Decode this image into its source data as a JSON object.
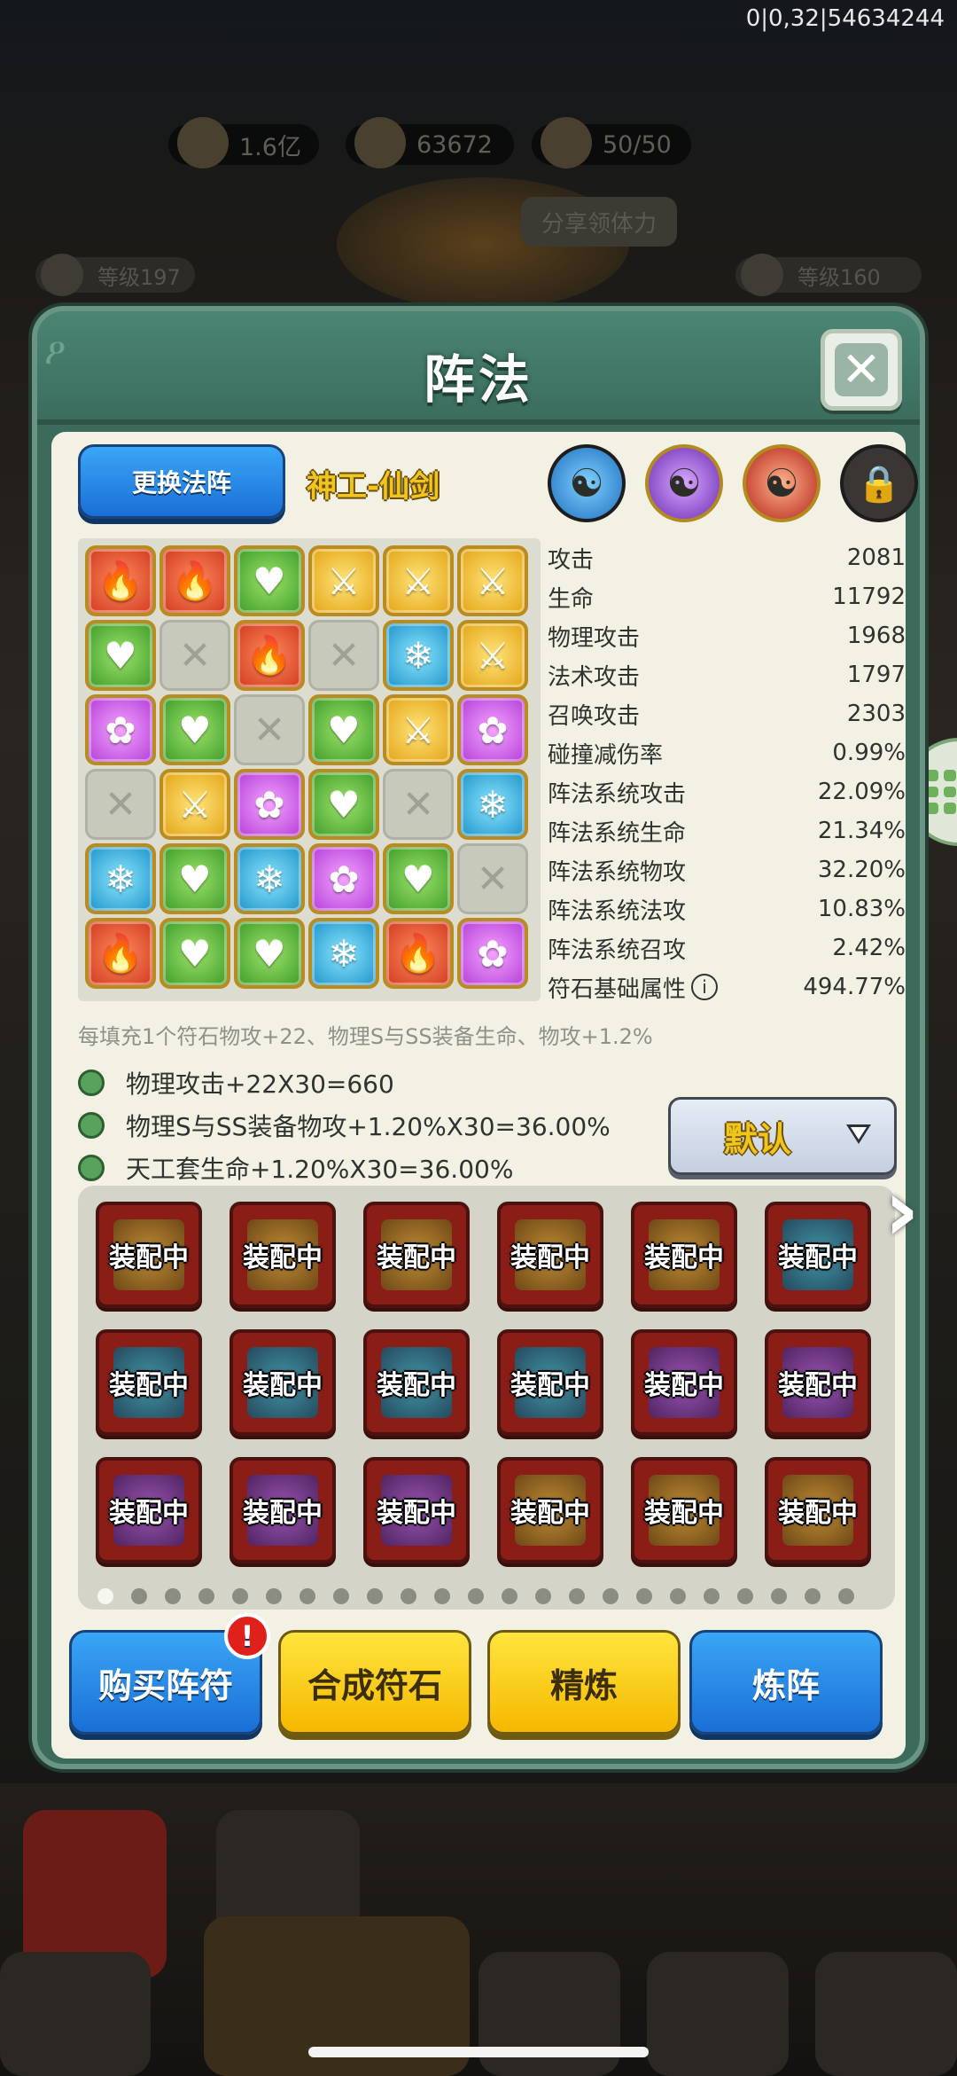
{
  "status": {
    "debug_text": "0|0,32|54634244"
  },
  "resources": [
    {
      "icon": "coin-icon",
      "value": "1.6亿"
    },
    {
      "icon": "heart-icon",
      "value": "63672"
    },
    {
      "icon": "drumstick-icon",
      "value": "50/50"
    }
  ],
  "share_label": "分享领体力",
  "levels": {
    "left": "等级197",
    "right": "等级160"
  },
  "panel": {
    "title": "阵法"
  },
  "top": {
    "change_label": "更换法阵",
    "formation_name": "神工-仙剑",
    "rune_types": [
      "water-yinyang-icon",
      "purple-yinyang-icon",
      "fire-yinyang-icon",
      "lock-icon"
    ]
  },
  "grid": [
    [
      "red",
      "red",
      "green",
      "yellow",
      "yellow",
      "yellow"
    ],
    [
      "green",
      "empty",
      "red",
      "empty",
      "blue",
      "yellow"
    ],
    [
      "purple",
      "green",
      "empty",
      "green",
      "yellow",
      "purple"
    ],
    [
      "empty",
      "yellow",
      "purple",
      "green",
      "empty",
      "blue"
    ],
    [
      "blue",
      "green",
      "blue",
      "purple",
      "green",
      "empty"
    ],
    [
      "red",
      "green",
      "green",
      "blue",
      "red",
      "purple"
    ]
  ],
  "stats": [
    {
      "label": "攻击",
      "value": "2081"
    },
    {
      "label": "生命",
      "value": "11792"
    },
    {
      "label": "物理攻击",
      "value": "1968"
    },
    {
      "label": "法术攻击",
      "value": "1797"
    },
    {
      "label": "召唤攻击",
      "value": "2303"
    },
    {
      "label": "碰撞减伤率",
      "value": "0.99%"
    },
    {
      "label": "阵法系统攻击",
      "value": "22.09%"
    },
    {
      "label": "阵法系统生命",
      "value": "21.34%"
    },
    {
      "label": "阵法系统物攻",
      "value": "32.20%"
    },
    {
      "label": "阵法系统法攻",
      "value": "10.83%"
    },
    {
      "label": "阵法系统召攻",
      "value": "2.42%"
    },
    {
      "label": "符石基础属性",
      "value": "494.77%",
      "info": "i"
    }
  ],
  "note": "每填充1个符石物攻+22、物理S与SS装备生命、物攻+1.2%",
  "bonuses": [
    "物理攻击+22X30=660",
    "物理S与SS装备物攻+1.20%X30=36.00%",
    "天工套生命+1.20%X30=36.00%"
  ],
  "sort": {
    "selected": "默认"
  },
  "slots": {
    "label": "装配中",
    "gems": [
      "gold",
      "gold",
      "gold",
      "gold",
      "gold",
      "teal",
      "teal",
      "teal",
      "teal",
      "teal",
      "purple",
      "purple",
      "purple",
      "purple",
      "purple",
      "gold",
      "gold",
      "gold"
    ]
  },
  "pager": {
    "count": 23,
    "active": 0
  },
  "actions": [
    {
      "label": "购买阵符",
      "style": "blue",
      "badge": "!"
    },
    {
      "label": "合成符石",
      "style": "yellow"
    },
    {
      "label": "精炼",
      "style": "yellow"
    },
    {
      "label": "炼阵",
      "style": "blue"
    }
  ],
  "colors": {
    "panel": "#3c6b5b",
    "body": "#f3f1e4",
    "accent_blue": "#1a6fd6",
    "accent_yellow": "#f5b800",
    "slot_red": "#8b1d17"
  }
}
